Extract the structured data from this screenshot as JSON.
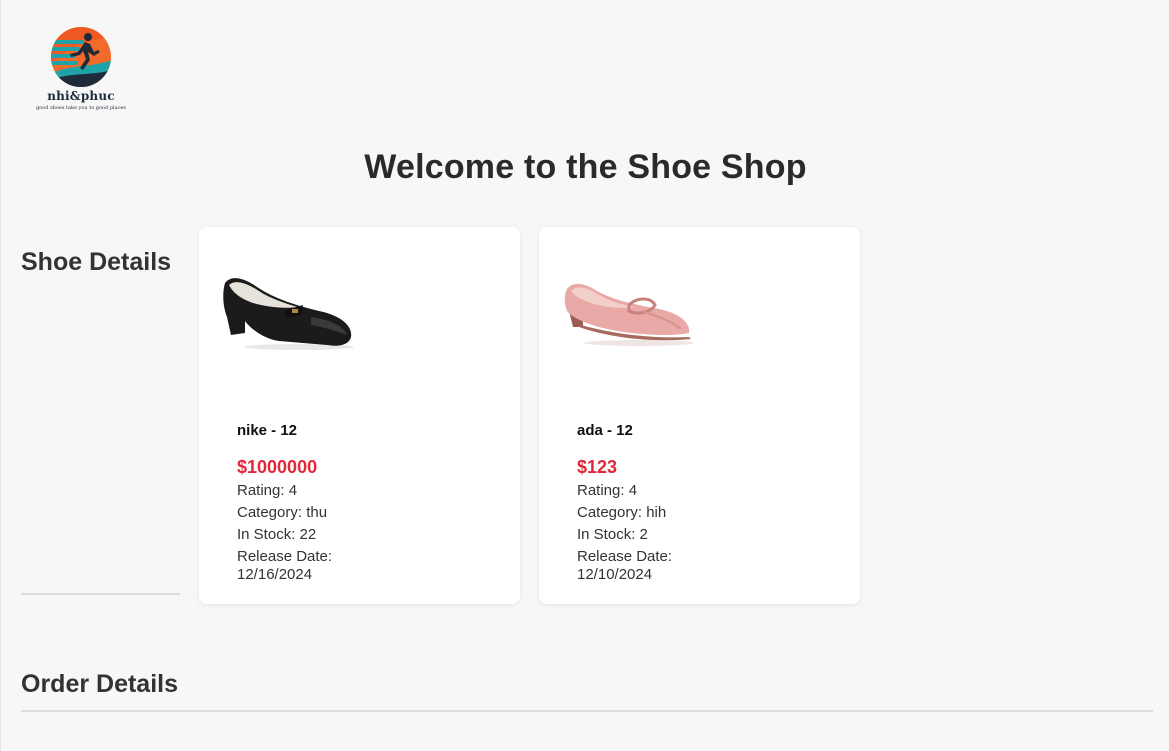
{
  "brand": {
    "name": "nhi&phuc",
    "tagline": "good shoes take you to good places",
    "colors": {
      "orange": "#f26b2a",
      "teal": "#1fa3a8",
      "navy": "#1f2b3a"
    }
  },
  "header": {
    "welcome": "Welcome to the Shoe Shop"
  },
  "shoe_section": {
    "heading": "Shoe Details"
  },
  "order_section": {
    "heading": "Order Details"
  },
  "shoes": [
    {
      "title": "nike - 12",
      "price": "$1000000",
      "rating": "Rating: 4",
      "category": "Category: thu",
      "stock": "In Stock: 22",
      "release": "Release Date: 12/16/2024",
      "image_icon": "black-low-heel-pump-icon"
    },
    {
      "title": "ada - 12",
      "price": "$123",
      "rating": "Rating: 4",
      "category": "Category: hih",
      "stock": "In Stock: 2",
      "release": "Release Date: 12/10/2024",
      "image_icon": "pink-low-heel-pump-icon"
    }
  ],
  "accent_price_color": "#e0283a"
}
